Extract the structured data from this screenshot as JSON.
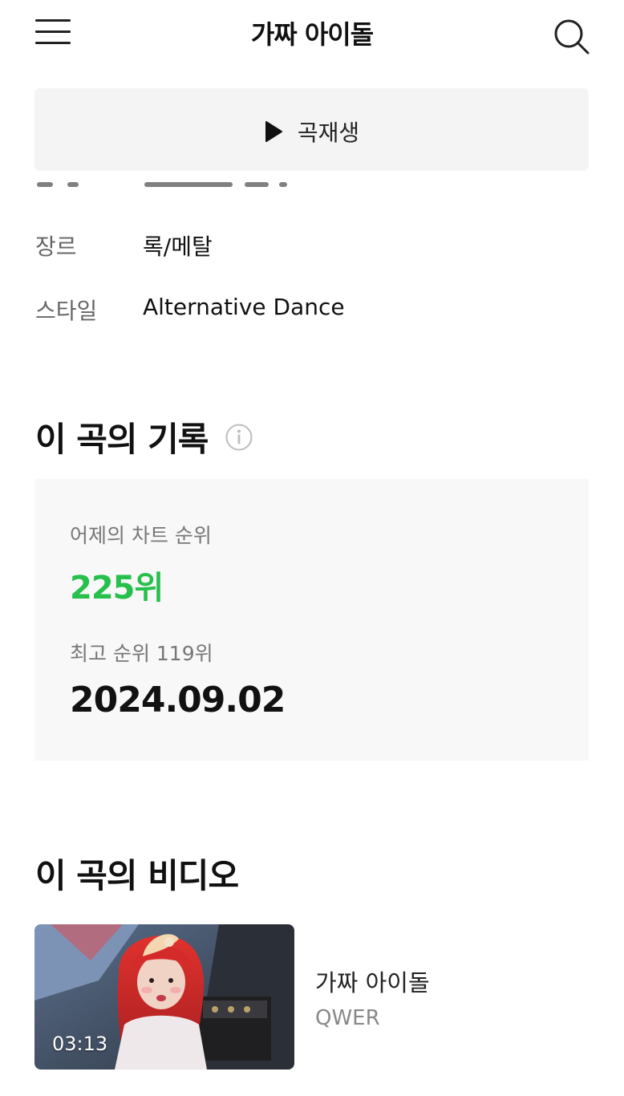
{
  "header": {
    "title": "가짜 아이돌",
    "menu_icon": "hamburger-menu-icon",
    "search_icon": "search-icon"
  },
  "play_bar": {
    "label": "곡재생",
    "icon": "play-icon"
  },
  "song_info": [
    {
      "key": "장르",
      "value": "록/메탈"
    },
    {
      "key": "스타일",
      "value": "Alternative Dance"
    }
  ],
  "record": {
    "title": "이 곡의 기록",
    "info_icon": "info-circle-icon",
    "yesterday_label": "어제의 차트 순위",
    "yesterday_rank": "225위",
    "best_label": "최고 순위 119위",
    "best_date": "2024.09.02"
  },
  "video": {
    "section_title": "이 곡의 비디오",
    "duration": "03:13",
    "title": "가짜 아이돌",
    "artist": "QWER"
  },
  "colors": {
    "accent_green": "#27c04c",
    "panel_bg": "#f8f8f8",
    "play_bar_bg": "#f4f4f4",
    "text_primary": "#111111",
    "text_secondary": "#777777"
  }
}
